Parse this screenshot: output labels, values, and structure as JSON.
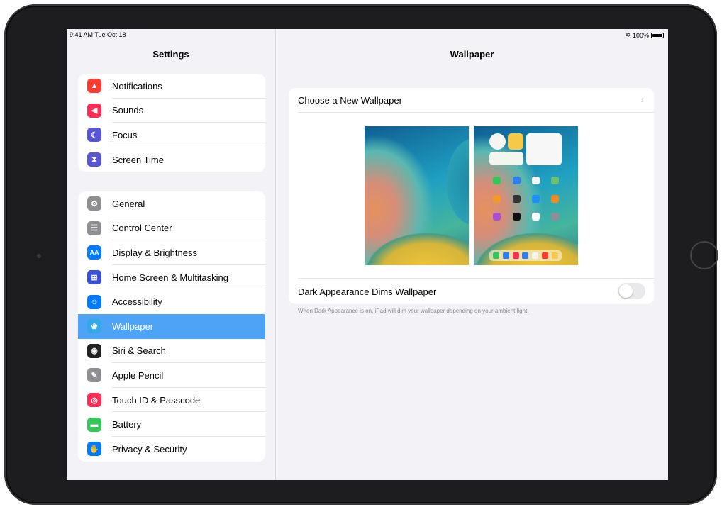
{
  "status_bar": {
    "time": "9:41 AM  Tue Oct 18",
    "battery": "100%"
  },
  "sidebar": {
    "title": "Settings",
    "group1": [
      {
        "label": "Notifications",
        "icon": "bell-icon",
        "color": "#ff3b30",
        "glyph": "▲"
      },
      {
        "label": "Sounds",
        "icon": "speaker-icon",
        "color": "#ff2d55",
        "glyph": "◀"
      },
      {
        "label": "Focus",
        "icon": "moon-icon",
        "color": "#5856d6",
        "glyph": "☾"
      },
      {
        "label": "Screen Time",
        "icon": "hourglass-icon",
        "color": "#5856d6",
        "glyph": "⧗"
      }
    ],
    "group2": [
      {
        "label": "General",
        "icon": "gear-icon",
        "color": "#8e8e93",
        "glyph": "⚙"
      },
      {
        "label": "Control Center",
        "icon": "switches-icon",
        "color": "#8e8e93",
        "glyph": "☰"
      },
      {
        "label": "Display & Brightness",
        "icon": "display-icon",
        "color": "#007aff",
        "glyph": "AA"
      },
      {
        "label": "Home Screen & Multitasking",
        "icon": "grid-icon",
        "color": "#3a50d9",
        "glyph": "⊞"
      },
      {
        "label": "Accessibility",
        "icon": "accessibility-icon",
        "color": "#007aff",
        "glyph": "☺"
      },
      {
        "label": "Wallpaper",
        "icon": "flower-icon",
        "color": "#35a9e8",
        "glyph": "❀",
        "selected": true
      },
      {
        "label": "Siri & Search",
        "icon": "siri-icon",
        "color": "#222222",
        "glyph": "◉"
      },
      {
        "label": "Apple Pencil",
        "icon": "pencil-icon",
        "color": "#8e8e93",
        "glyph": "✎"
      },
      {
        "label": "Touch ID & Passcode",
        "icon": "fingerprint-icon",
        "color": "#ff2d55",
        "glyph": "◎"
      },
      {
        "label": "Battery",
        "icon": "battery-icon",
        "color": "#34c759",
        "glyph": "▬"
      },
      {
        "label": "Privacy & Security",
        "icon": "hand-icon",
        "color": "#007aff",
        "glyph": "✋"
      }
    ]
  },
  "detail": {
    "title": "Wallpaper",
    "choose_label": "Choose a New Wallpaper",
    "dark_label": "Dark Appearance Dims Wallpaper",
    "dark_enabled": false,
    "footnote": "When Dark Appearance is on, iPad will dim your wallpaper depending on your ambient light."
  }
}
